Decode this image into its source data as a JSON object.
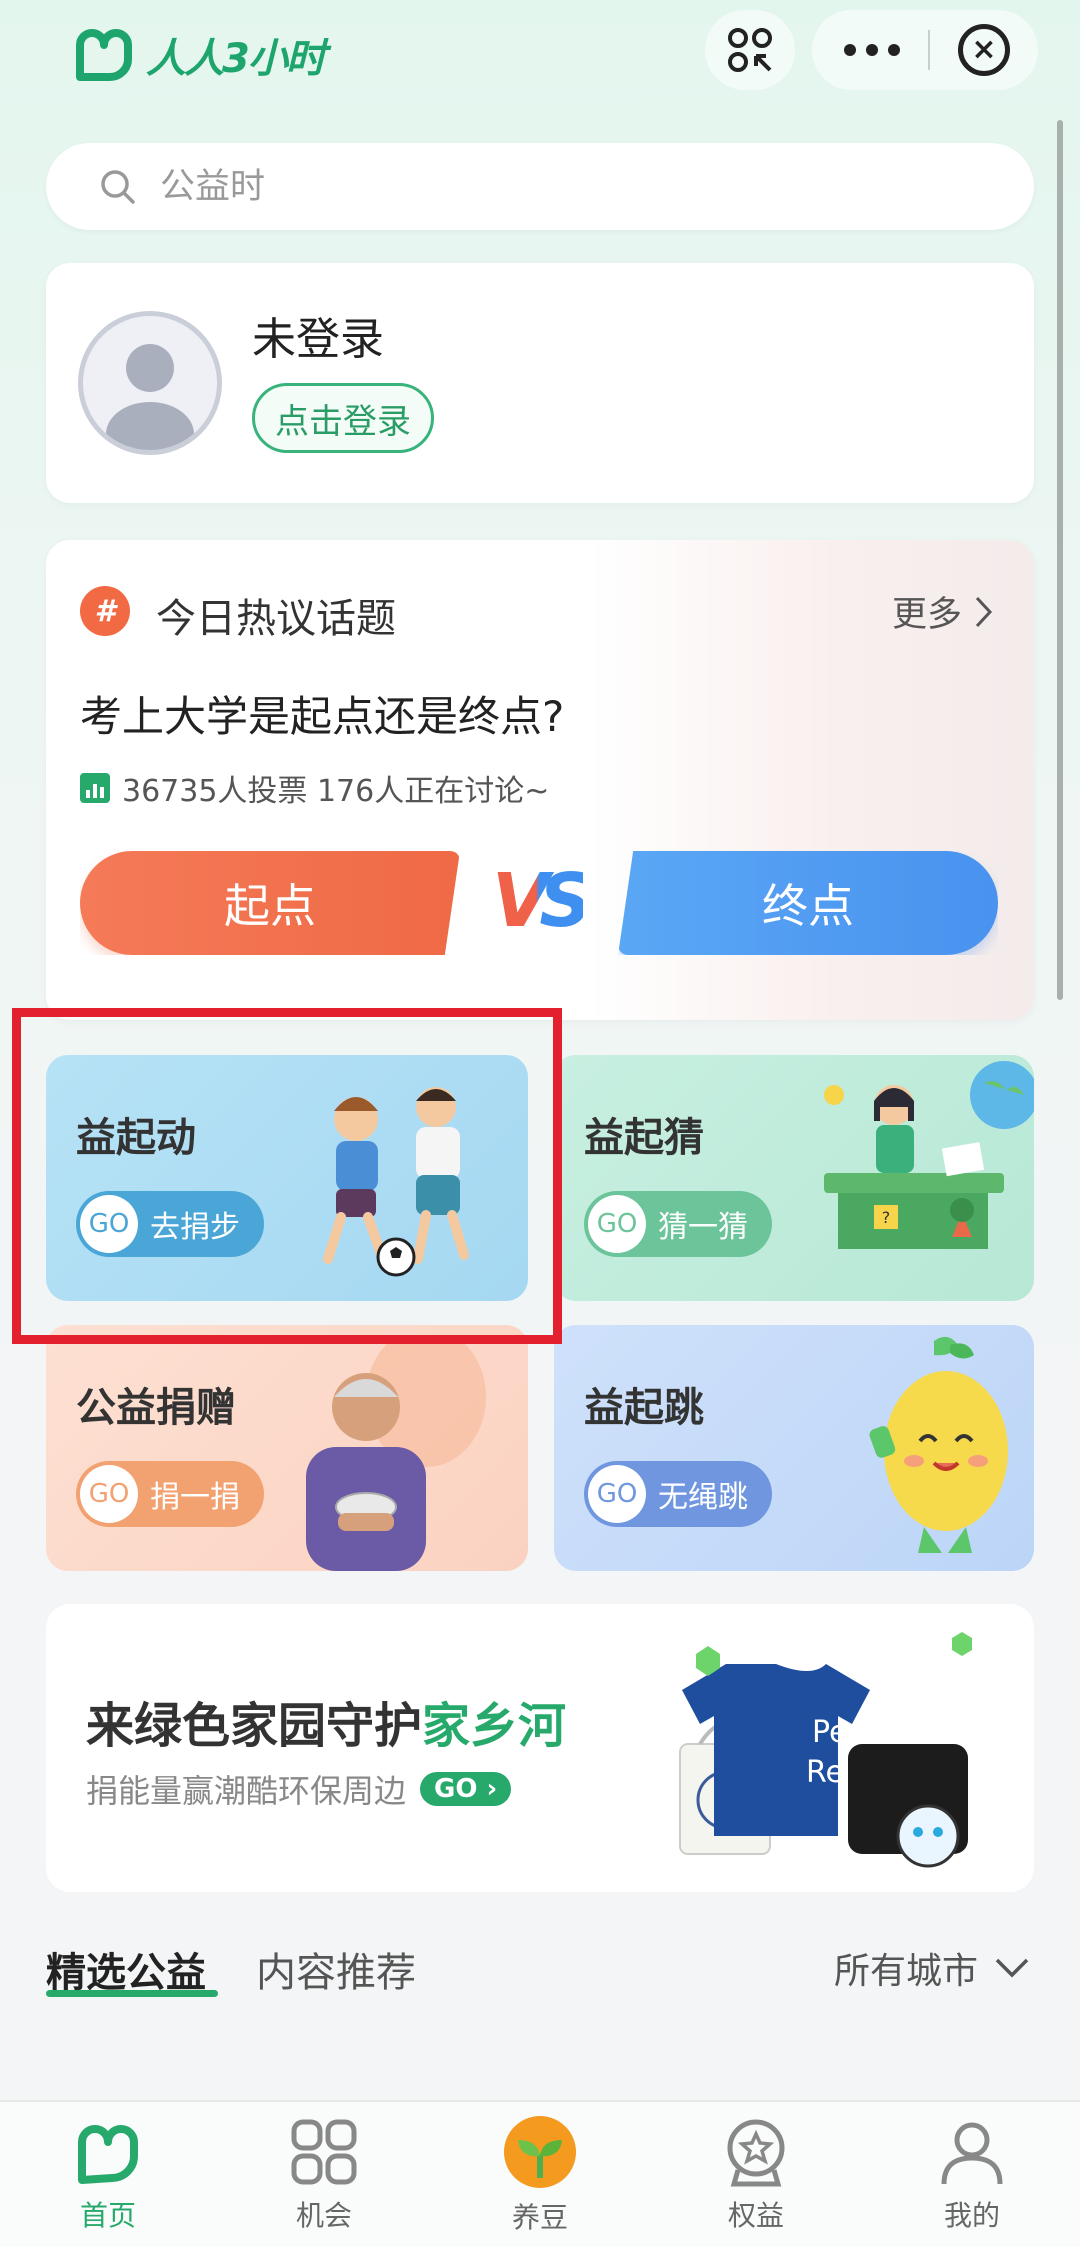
{
  "header": {
    "logo_text": "人人3小时",
    "more_icon": "more-dots-icon",
    "close_icon": "close-circle-icon",
    "scan_icon": "scan-icon"
  },
  "search": {
    "placeholder": "公益时"
  },
  "profile": {
    "status": "未登录",
    "login_button": "点击登录"
  },
  "topic": {
    "section_title": "今日热议话题",
    "more_label": "更多",
    "question": "考上大学是起点还是终点?",
    "stats": "36735人投票 176人正在讨论~",
    "option_a": "起点",
    "vs": "VS",
    "option_b": "终点"
  },
  "cards": [
    {
      "title": "益起动",
      "go_icon": "GO",
      "action": "去捐步",
      "color": "#4aa6d6"
    },
    {
      "title": "益起猜",
      "go_icon": "GO",
      "action": "猜一猜",
      "color": "#6cc49a"
    },
    {
      "title": "公益捐赠",
      "go_icon": "GO",
      "action": "捐一捐",
      "color": "#f2a170"
    },
    {
      "title": "益起跳",
      "go_icon": "GO",
      "action": "无绳跳",
      "color": "#6f96df"
    }
  ],
  "banner": {
    "title_prefix": "来绿色家园守护",
    "title_highlight": "家乡河",
    "subtitle": "捐能量赢潮酷环保周边",
    "go_label": "GO",
    "shirt_text_1": "PepsiCo",
    "shirt_text_2": "Recycling"
  },
  "tabs": {
    "tab1": "精选公益",
    "tab2": "内容推荐",
    "city_filter": "所有城市"
  },
  "nav": [
    {
      "label": "首页",
      "icon": "home-icon",
      "active": true
    },
    {
      "label": "机会",
      "icon": "grid-icon",
      "active": false
    },
    {
      "label": "养豆",
      "icon": "sprout-icon",
      "active": false
    },
    {
      "label": "权益",
      "icon": "badge-icon",
      "active": false
    },
    {
      "label": "我的",
      "icon": "user-icon",
      "active": false
    }
  ],
  "colors": {
    "accent": "#27a96c",
    "highlight_border": "#e3202e",
    "option_a": "#f06f4b",
    "option_b": "#4f98f1"
  }
}
